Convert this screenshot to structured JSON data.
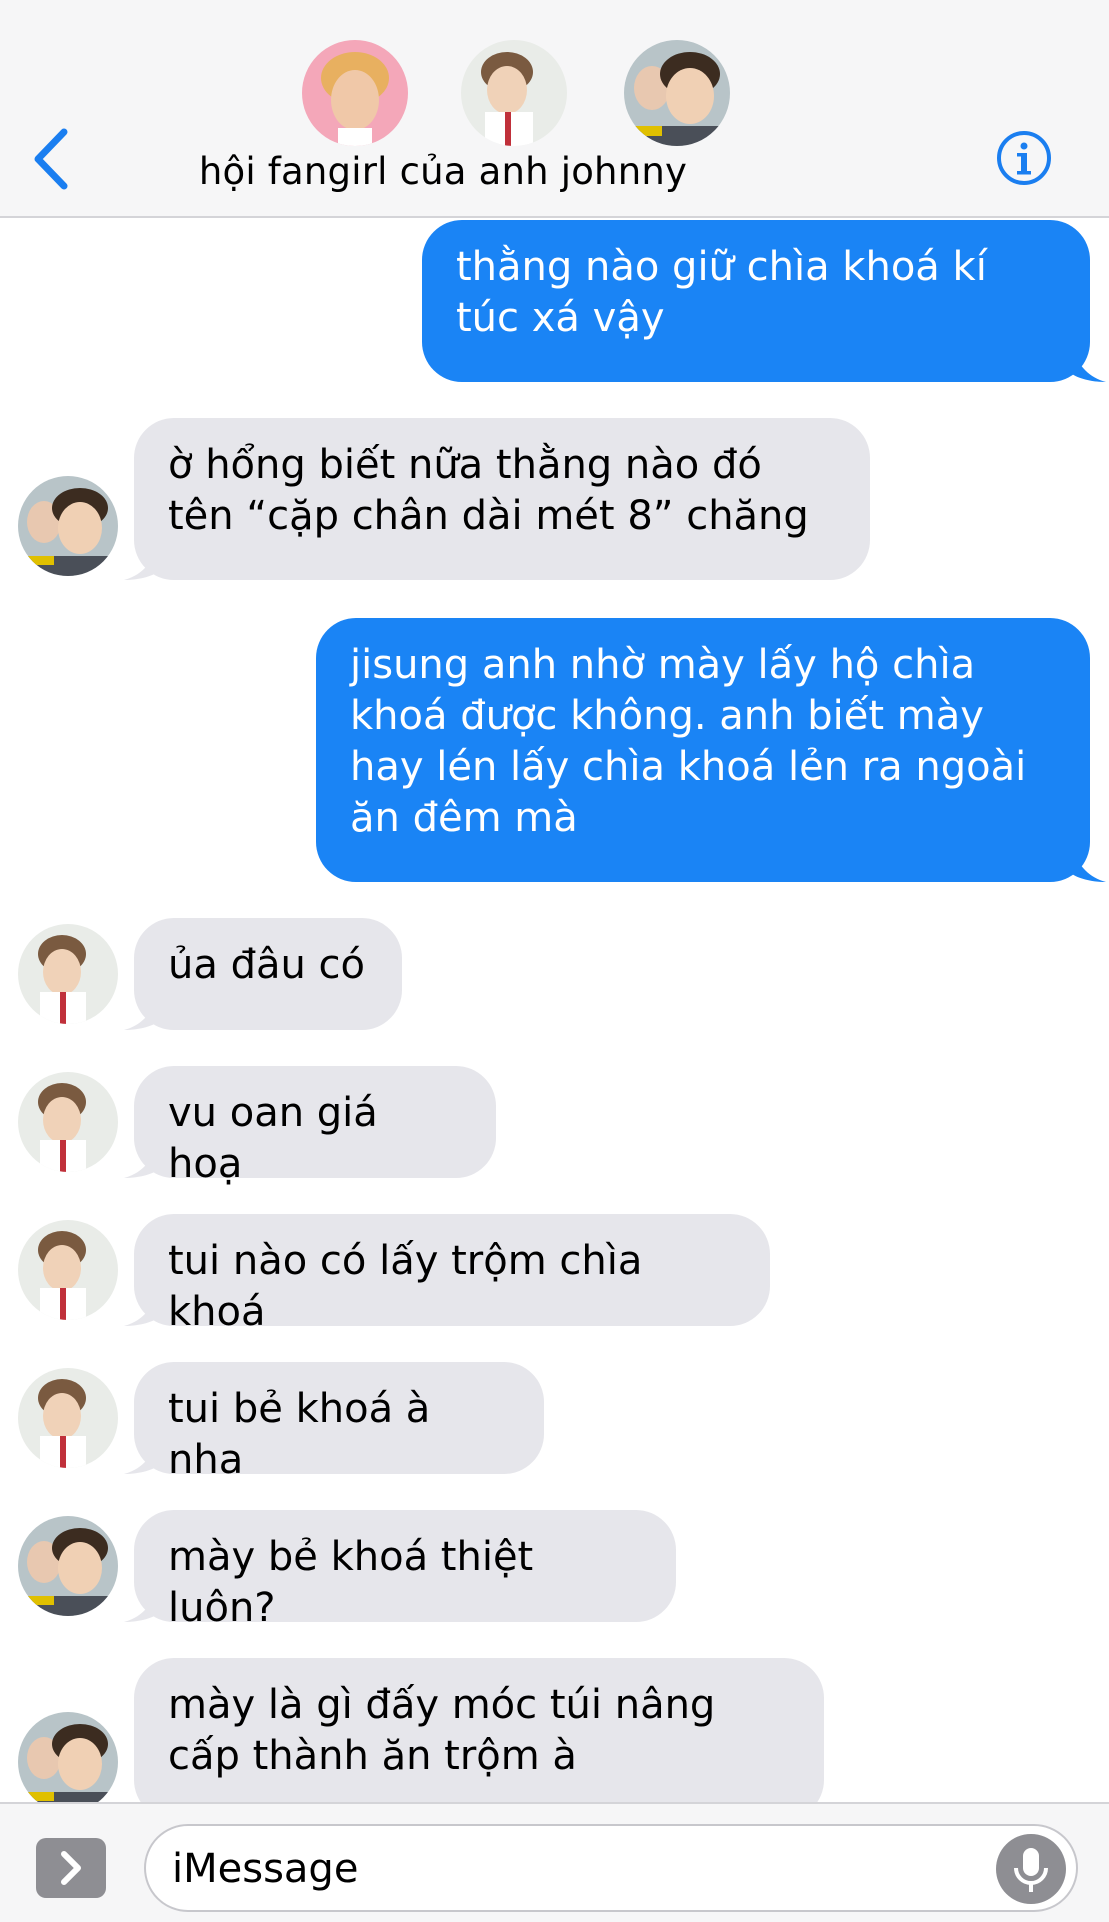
{
  "header": {
    "title": "hội fangirl của anh johnny",
    "back_icon": "chevron-left-icon",
    "info_icon": "info-icon",
    "accent": "#1a7ef0",
    "avatars": [
      "member-avatar-1",
      "member-avatar-2",
      "member-avatar-3"
    ]
  },
  "messages": [
    {
      "side": "sent",
      "text": "thằng nào giữ chìa khoá kí túc xá vậy"
    },
    {
      "side": "recv",
      "text": "ờ hổng biết nữa thằng nào đó tên “cặp chân dài mét 8” chăng"
    },
    {
      "side": "sent",
      "text": "jisung anh nhờ mày lấy hộ chìa khoá được không. anh biết mày hay lén lấy chìa khoá lẻn ra ngoài ăn đêm mà"
    },
    {
      "side": "recv",
      "text": "ủa đâu có"
    },
    {
      "side": "recv",
      "text": "vu oan giá hoạ"
    },
    {
      "side": "recv",
      "text": "tui nào có lấy trộm chìa khoá"
    },
    {
      "side": "recv",
      "text": "tui bẻ khoá à nha"
    },
    {
      "side": "recv",
      "text": "mày bẻ khoá thiệt luôn?"
    },
    {
      "side": "recv",
      "text": "mày là gì đấy móc túi nâng cấp thành ăn trộm à"
    }
  ],
  "composer": {
    "placeholder": "iMessage",
    "apps_icon": "chevron-right-icon",
    "mic_icon": "microphone-icon"
  },
  "colors": {
    "sent_bubble": "#1a84f5",
    "received_bubble": "#e6e6eb",
    "header_bg": "#f6f6f7"
  }
}
